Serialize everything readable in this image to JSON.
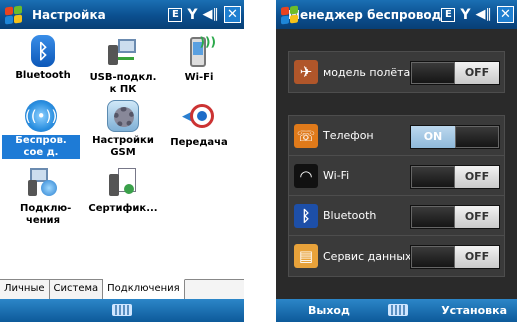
{
  "left": {
    "title": "Настройка",
    "status": {
      "network_type": "E",
      "signal": "Y",
      "volume": "◀∥",
      "close": "✕"
    },
    "items": [
      {
        "label": "Bluetooth",
        "icon": "bluetooth-icon"
      },
      {
        "label": "USB-подкл. к ПК",
        "icon": "usb-to-pc-icon"
      },
      {
        "label": "Wi-Fi",
        "icon": "wifi-icon"
      },
      {
        "label": "Беспров. сое д.",
        "icon": "wireless-icon",
        "selected": true
      },
      {
        "label": "Настройки GSM",
        "icon": "gsm-settings-icon"
      },
      {
        "label": "Передача",
        "icon": "beam-icon"
      },
      {
        "label": "Подклю- чения",
        "icon": "connections-icon"
      },
      {
        "label": "Сертифик...",
        "icon": "certificates-icon"
      }
    ],
    "tabs": [
      "Личные",
      "Система",
      "Подключения"
    ],
    "active_tab": "Подключения"
  },
  "right": {
    "title": "Менеджер беспровод",
    "status": {
      "network_type": "E",
      "signal": "Y",
      "volume": "◀∥",
      "close": "✕"
    },
    "rows": [
      {
        "label": "модель полёта",
        "icon": "airplane-icon",
        "state": "OFF",
        "icon_color": "#b0562a"
      },
      {
        "label": "Телефон",
        "icon": "phone-icon",
        "state": "ON",
        "icon_color": "#e07a1a"
      },
      {
        "label": "Wi-Fi",
        "icon": "wifi-icon",
        "state": "OFF",
        "icon_color": "#111111"
      },
      {
        "label": "Bluetooth",
        "icon": "bluetooth-icon",
        "state": "OFF",
        "icon_color": "#1d4fa8"
      },
      {
        "label": "Сервис данных",
        "icon": "data-service-icon",
        "state": "OFF",
        "icon_color": "#e8a23a"
      }
    ],
    "softkeys": {
      "left": "Выход",
      "right": "Установка"
    }
  },
  "colors": {
    "titlebar": "#0b4f8f",
    "selection": "#1e7bd6",
    "toggle_on": "#8fb9da"
  }
}
